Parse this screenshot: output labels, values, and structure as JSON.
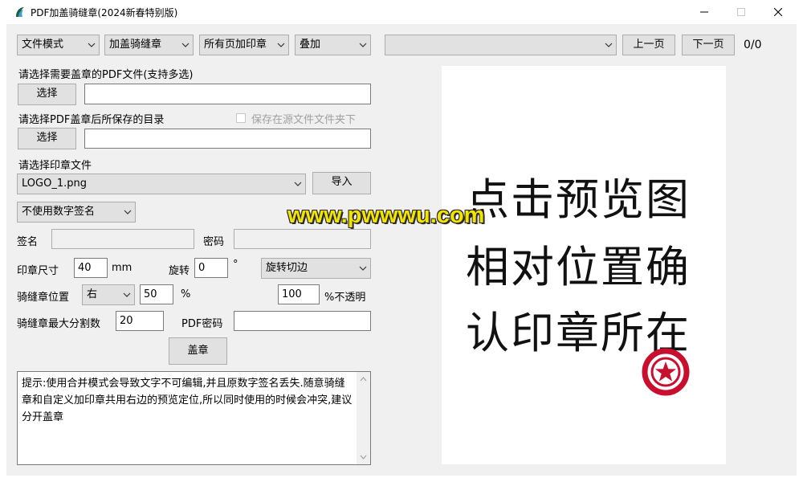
{
  "window": {
    "title": "PDF加盖骑缝章(2024新春特别版)"
  },
  "toolbar": {
    "mode": "文件模式",
    "stamp_type": "加盖骑缝章",
    "page_range": "所有页加印章",
    "overlay": "叠加",
    "file_selector": "",
    "prev_page": "上一页",
    "next_page": "下一页",
    "page_counter": "0/0"
  },
  "form": {
    "pdf_label": "请选择需要盖章的PDF文件(支持多选)",
    "pdf_choose": "选择",
    "pdf_path": "",
    "save_label": "请选择PDF盖章后所保存的目录",
    "save_in_source": "保存在源文件文件夹下",
    "save_choose": "选择",
    "save_path": "",
    "seal_label": "请选择印章文件",
    "seal_file": "LOGO_1.png",
    "import": "导入",
    "signature_mode": "不使用数字签名",
    "sign_label": "签名",
    "sign_value": "",
    "password_label": "密码",
    "password_value": "",
    "size_label": "印章尺寸",
    "size_value": "40",
    "size_unit": "mm",
    "rotate_label": "旋转",
    "rotate_value": "0",
    "rotate_unit": "°",
    "rotate_mode": "旋转切边",
    "position_label": "骑缝章位置",
    "position_value": "右",
    "position_percent": "50",
    "percent_sign": "%",
    "opacity_value": "100",
    "opacity_label": "%不透明",
    "max_split_label": "骑缝章最大分割数",
    "max_split_value": "20",
    "pdf_password_label": "PDF密码",
    "pdf_password_value": "",
    "stamp_button": "盖章",
    "hint": "提示:使用合并模式会导致文字不可编辑,并且原数字签名丢失.随意骑缝章和自定义加印章共用右边的预览定位,所以同时使用的时候会冲突,建议分开盖章"
  },
  "preview": {
    "line1": "点击预览图",
    "line2": "相对位置确",
    "line3": "认印章所在",
    "watermark": "www.pwwwu.com"
  },
  "colors": {
    "window_bg": "#f0f0f0",
    "stamp_red": "#c8102e",
    "watermark_yellow": "#f2e400"
  }
}
